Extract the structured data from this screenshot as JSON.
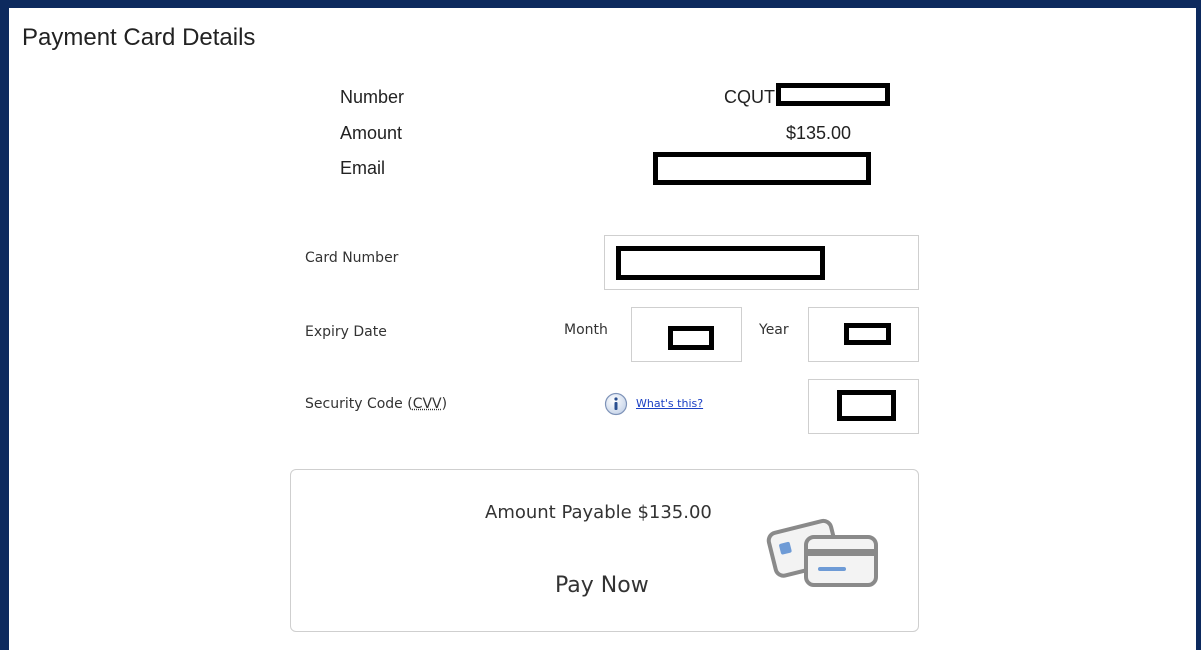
{
  "page": {
    "title": "Payment Card Details"
  },
  "summary": {
    "number_label": "Number",
    "number_prefix": "CQUT",
    "amount_label": "Amount",
    "amount_value": "$135.00",
    "email_label": "Email"
  },
  "form": {
    "card_number_label": "Card Number",
    "expiry_label": "Expiry Date",
    "month_label": "Month",
    "year_label": "Year",
    "security_label_prefix": "Security Code (",
    "security_label_abbr": "CVV",
    "security_label_suffix": ")",
    "help_link": "What's this?"
  },
  "payment": {
    "amount_payable": "Amount Payable $135.00",
    "pay_now": "Pay Now"
  },
  "icons": {
    "info": "info-icon",
    "cards": "credit-cards-icon"
  },
  "colors": {
    "frame": "#0d2a5e",
    "link": "#1a3fc4",
    "border": "#cfcfcf"
  }
}
